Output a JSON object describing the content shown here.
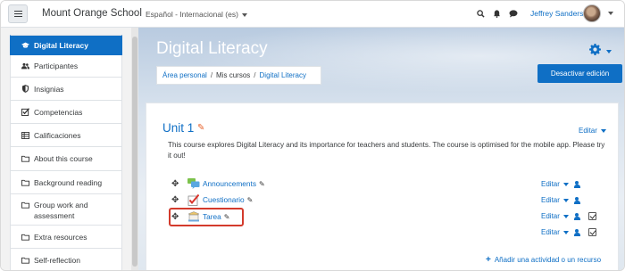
{
  "navbar": {
    "site_name": "Mount Orange School",
    "language": "Español - Internacional (es)",
    "user_name": "Jeffrey Sanders",
    "icons": [
      "search-icon",
      "bell-icon",
      "chat-icon"
    ]
  },
  "sidebar": {
    "items": [
      {
        "label": "Digital Literacy",
        "icon": "graduation-cap-icon",
        "active": true
      },
      {
        "label": "Participantes",
        "icon": "users-icon"
      },
      {
        "label": "Insignias",
        "icon": "shield-icon"
      },
      {
        "label": "Competencias",
        "icon": "checkbox-icon"
      },
      {
        "label": "Calificaciones",
        "icon": "table-icon"
      },
      {
        "label": "About this course",
        "icon": "folder-icon"
      },
      {
        "label": "Background reading",
        "icon": "folder-icon"
      },
      {
        "label": "Group work and assessment",
        "icon": "folder-icon"
      },
      {
        "label": "Extra resources",
        "icon": "folder-icon"
      },
      {
        "label": "Self-reflection",
        "icon": "folder-icon"
      }
    ]
  },
  "header": {
    "title": "Digital Literacy",
    "breadcrumb": [
      "Área personal",
      "Mis cursos",
      "Digital Literacy"
    ],
    "edit_button": "Desactivar edición"
  },
  "section": {
    "title": "Unit 1",
    "edit_label": "Editar",
    "description": "This course explores Digital Literacy and its importance for teachers and students. The course is optimised for the mobile app. Please try it out!",
    "activities": [
      {
        "name": "Announcements",
        "icon": "forum-icon",
        "edit": "Editar"
      },
      {
        "name": "Cuestionario",
        "icon": "quiz-icon",
        "edit": "Editar"
      },
      {
        "name": "Tarea",
        "icon": "assignment-icon",
        "edit": "Editar",
        "highlighted": true
      }
    ],
    "extra_row_edit": "Editar",
    "add_activity": "Añadir una actividad o un recurso"
  },
  "colors": {
    "brand": "#0f6fc5",
    "highlight": "#d33a2c"
  }
}
